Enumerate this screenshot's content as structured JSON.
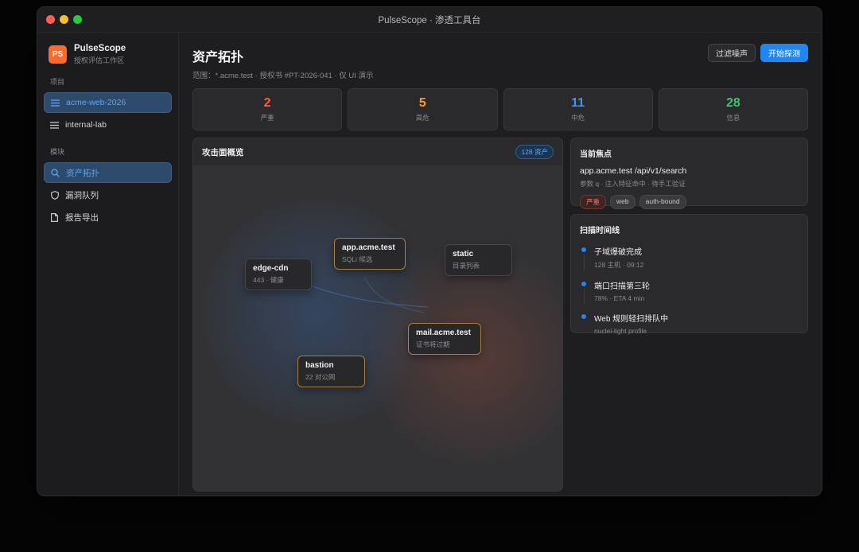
{
  "window": {
    "title": "PulseScope · 渗透工具台"
  },
  "brand": {
    "logo": "PS",
    "name": "PulseScope",
    "subtitle": "授权评估工作区"
  },
  "sidebar": {
    "projects_label": "项目",
    "projects": [
      {
        "label": "acme-web-2026",
        "icon": "list-icon",
        "active": true
      },
      {
        "label": "internal-lab",
        "icon": "list-icon",
        "active": false
      }
    ],
    "modules_label": "模块",
    "modules": [
      {
        "label": "资产拓扑",
        "icon": "search-icon",
        "active": true
      },
      {
        "label": "漏洞队列",
        "icon": "shield-icon",
        "active": false
      },
      {
        "label": "报告导出",
        "icon": "document-icon",
        "active": false
      }
    ]
  },
  "header": {
    "title": "资产拓扑",
    "scope": "范围：*.acme.test · 授权书 #PT-2026-041 · 仅 UI 演示",
    "filter_label": "过滤噪声",
    "start_label": "开始探测"
  },
  "stats": [
    {
      "value": "2",
      "label": "严重",
      "color": "#ff5a4a"
    },
    {
      "value": "5",
      "label": "高危",
      "color": "#ff9a2e"
    },
    {
      "value": "11",
      "label": "中危",
      "color": "#3d94ff"
    },
    {
      "value": "28",
      "label": "信息",
      "color": "#3ec46d"
    }
  ],
  "overview": {
    "title": "攻击面概览",
    "badge": "128 资产",
    "nodes": [
      {
        "name": "edge-cdn",
        "sub": "443 · 健康",
        "warn": false
      },
      {
        "name": "app.acme.test",
        "sub": "SQLi 候选",
        "warn": true
      },
      {
        "name": "static",
        "sub": "目录列表",
        "warn": false
      },
      {
        "name": "mail.acme.test",
        "sub": "证书将过期",
        "warn": true
      },
      {
        "name": "bastion",
        "sub": "22 对公网",
        "warn": true
      }
    ]
  },
  "focus": {
    "title": "当前焦点",
    "target": "app.acme.test /api/v1/search",
    "desc": "参数 q · 注入特征命中 · 待手工验证",
    "tags": [
      "严重",
      "web",
      "auth-bound"
    ]
  },
  "timeline": {
    "title": "扫描时间线",
    "items": [
      {
        "title": "子域爆破完成",
        "sub": "128 主机 · 09:12"
      },
      {
        "title": "端口扫描第三轮",
        "sub": "78% · ETA 4 min"
      },
      {
        "title": "Web 规则轻扫排队中",
        "sub": "nuclei-light profile"
      }
    ]
  }
}
